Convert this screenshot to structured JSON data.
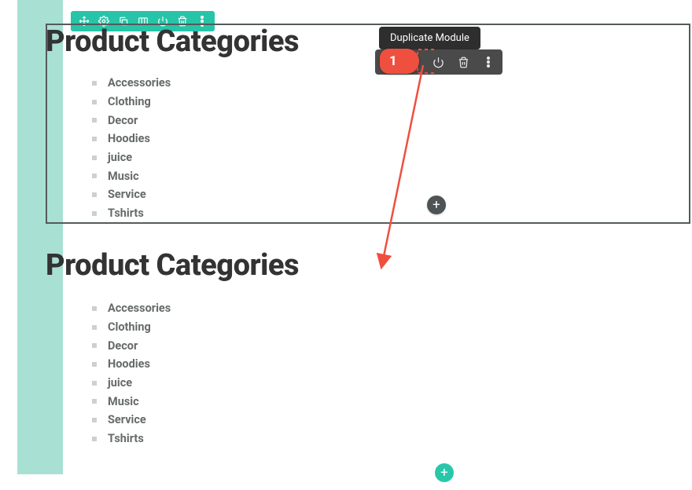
{
  "toolbar_teal": {
    "items": [
      "move-icon",
      "gear-icon",
      "duplicate-icon",
      "columns-icon",
      "power-icon",
      "trash-icon",
      "more-icon"
    ]
  },
  "module1": {
    "title": "Product Categories",
    "items": [
      "Accessories",
      "Clothing",
      "Decor",
      "Hoodies",
      "juice",
      "Music",
      "Service",
      "Tshirts"
    ]
  },
  "module2": {
    "title": "Product Categories",
    "items": [
      "Accessories",
      "Clothing",
      "Decor",
      "Hoodies",
      "juice",
      "Music",
      "Service",
      "Tshirts"
    ]
  },
  "tooltip": {
    "text": "Duplicate Module"
  },
  "toolbar_dark": {
    "items": [
      "duplicate-icon",
      "power-icon",
      "trash-icon",
      "more-icon"
    ]
  },
  "marker": {
    "label": "1"
  },
  "plus": {
    "glyph": "+"
  }
}
